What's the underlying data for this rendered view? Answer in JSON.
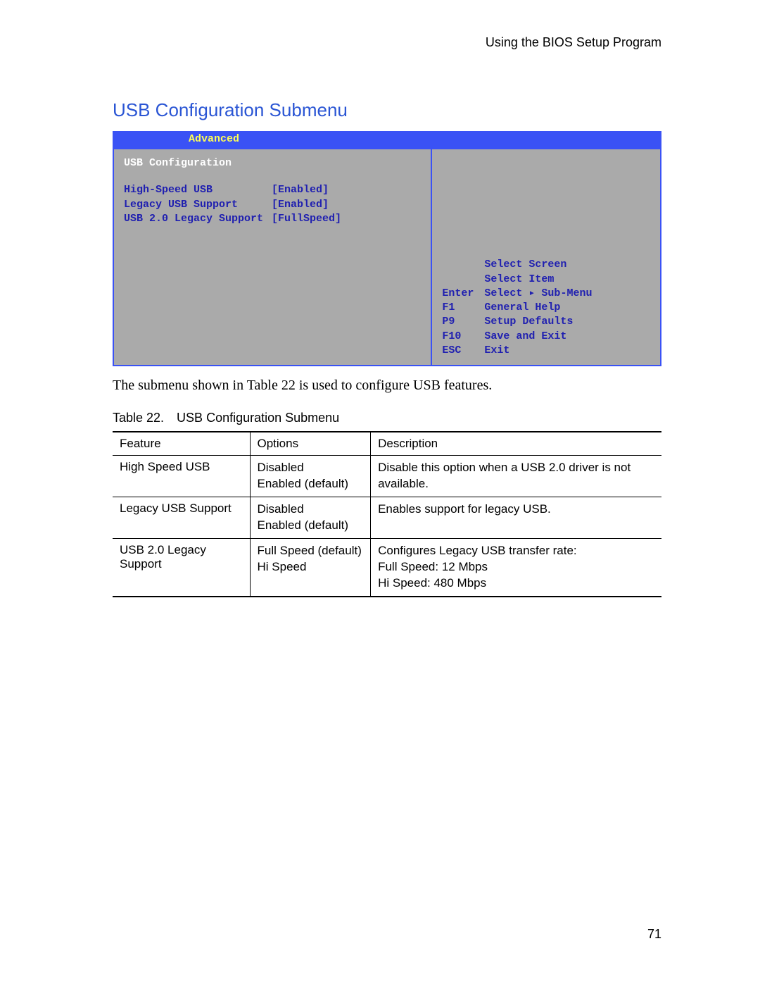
{
  "header": "Using the BIOS Setup Program",
  "section_title": "USB Configuration Submenu",
  "bios": {
    "menubar_tab": "Advanced",
    "subtitle": "USB Configuration",
    "settings": [
      {
        "label": "High-Speed USB",
        "value": "[Enabled]"
      },
      {
        "label": "Legacy USB Support",
        "value": "[Enabled]"
      },
      {
        "label": "USB 2.0 Legacy Support",
        "value": "[FullSpeed]"
      }
    ],
    "help": [
      {
        "key": "",
        "desc": "Select Screen"
      },
      {
        "key": "",
        "desc": "Select Item"
      },
      {
        "key": "Enter",
        "desc": "Select ▸ Sub-Menu"
      },
      {
        "key": "F1",
        "desc": "General Help"
      },
      {
        "key": "P9",
        "desc": "Setup Defaults"
      },
      {
        "key": "F10",
        "desc": "Save and Exit"
      },
      {
        "key": "ESC",
        "desc": "Exit"
      }
    ]
  },
  "paragraph": "The submenu shown in Table 22 is used to configure USB features.",
  "table_caption": "Table 22. USB Configuration Submenu",
  "table": {
    "headers": {
      "feature": "Feature",
      "options": "Options",
      "description": "Description"
    },
    "rows": [
      {
        "feature": "High Speed USB",
        "options": [
          "Disabled",
          "Enabled (default)"
        ],
        "description": "Disable this option when a USB 2.0 driver is not available."
      },
      {
        "feature": "Legacy USB Support",
        "options": [
          "Disabled",
          "Enabled (default)"
        ],
        "description": "Enables support for legacy USB."
      },
      {
        "feature": "USB 2.0 Legacy Support",
        "options": [
          "Full Speed (default)",
          "Hi Speed"
        ],
        "description": "Configures Legacy USB transfer rate:\nFull Speed:  12 Mbps\nHi Speed:  480 Mbps"
      }
    ]
  },
  "page_number": "71"
}
